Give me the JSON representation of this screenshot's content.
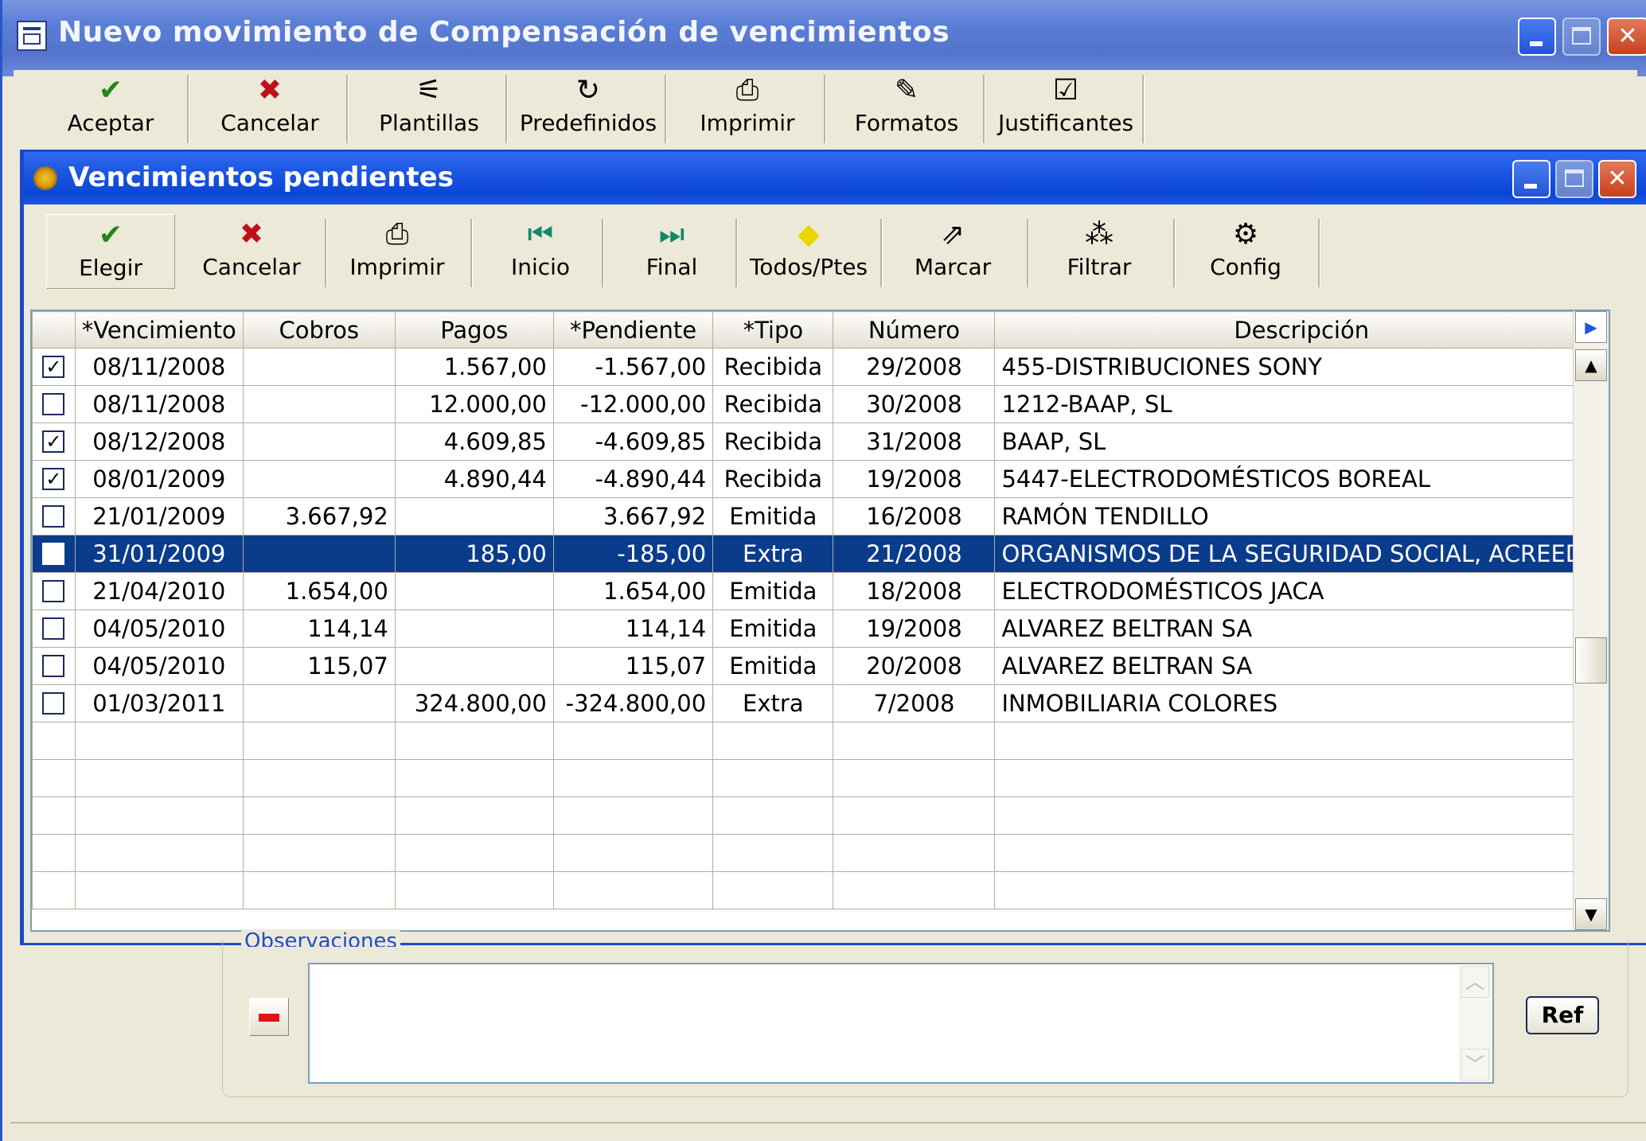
{
  "window": {
    "title": "Nuevo movimiento de Compensación de vencimientos",
    "icon": "window-icon"
  },
  "main_toolbar": [
    {
      "label": "Aceptar",
      "icon": "checkmark-icon",
      "glyph": "✔"
    },
    {
      "label": "Cancelar",
      "icon": "x-icon",
      "glyph": "✖"
    },
    {
      "label": "Plantillas",
      "icon": "wand-icon",
      "glyph": "⚟"
    },
    {
      "label": "Predefinidos",
      "icon": "refresh-icon",
      "glyph": "↻"
    },
    {
      "label": "Imprimir",
      "icon": "printer-icon",
      "glyph": "⎙"
    },
    {
      "label": "Formatos",
      "icon": "formats-icon",
      "glyph": "✎"
    },
    {
      "label": "Justificantes",
      "icon": "clipboard-check-icon",
      "glyph": "☑"
    }
  ],
  "inner_window": {
    "title": "Vencimientos pendientes",
    "icon": "sun-icon"
  },
  "inner_toolbar": [
    {
      "label": "Elegir",
      "icon": "checkmark-icon",
      "glyph": "✔"
    },
    {
      "label": "Cancelar",
      "icon": "x-icon",
      "glyph": "✖"
    },
    {
      "label": "Imprimir",
      "icon": "printer-icon",
      "glyph": "⎙"
    },
    {
      "label": "Inicio",
      "icon": "first-icon",
      "glyph": "⏮"
    },
    {
      "label": "Final",
      "icon": "last-icon",
      "glyph": "⏭"
    },
    {
      "label": "Todos/Ptes",
      "icon": "diamond-icon",
      "glyph": "◆"
    },
    {
      "label": "Marcar",
      "icon": "mark-icon",
      "glyph": "⇗"
    },
    {
      "label": "Filtrar",
      "icon": "filter-icon",
      "glyph": "⁂"
    },
    {
      "label": "Config",
      "icon": "gear-icon",
      "glyph": "⚙"
    }
  ],
  "grid": {
    "columns": [
      "*Vencimiento",
      "Cobros",
      "Pagos",
      "*Pendiente",
      "*Tipo",
      "Número",
      "Descripción"
    ],
    "rows": [
      {
        "checked": true,
        "vencimiento": "08/11/2008",
        "cobros": "",
        "pagos": "1.567,00",
        "pendiente": "-1.567,00",
        "tipo": "Recibida",
        "numero": "29/2008",
        "descripcion": "455-DISTRIBUCIONES SONY"
      },
      {
        "checked": false,
        "vencimiento": "08/11/2008",
        "cobros": "",
        "pagos": "12.000,00",
        "pendiente": "-12.000,00",
        "tipo": "Recibida",
        "numero": "30/2008",
        "descripcion": "1212-BAAP, SL"
      },
      {
        "checked": true,
        "vencimiento": "08/12/2008",
        "cobros": "",
        "pagos": "4.609,85",
        "pendiente": "-4.609,85",
        "tipo": "Recibida",
        "numero": "31/2008",
        "descripcion": "BAAP, SL"
      },
      {
        "checked": true,
        "vencimiento": "08/01/2009",
        "cobros": "",
        "pagos": "4.890,44",
        "pendiente": "-4.890,44",
        "tipo": "Recibida",
        "numero": "19/2008",
        "descripcion": "5447-ELECTRODOMÉSTICOS BOREAL"
      },
      {
        "checked": false,
        "vencimiento": "21/01/2009",
        "cobros": "3.667,92",
        "pagos": "",
        "pendiente": "3.667,92",
        "tipo": "Emitida",
        "numero": "16/2008",
        "descripcion": "RAMÓN TENDILLO"
      },
      {
        "checked": false,
        "selected": true,
        "vencimiento": "31/01/2009",
        "cobros": "",
        "pagos": "185,00",
        "pendiente": "-185,00",
        "tipo": "Extra",
        "numero": "21/2008",
        "descripcion": "ORGANISMOS DE LA SEGURIDAD SOCIAL, ACREEDO"
      },
      {
        "checked": false,
        "vencimiento": "21/04/2010",
        "cobros": "1.654,00",
        "pagos": "",
        "pendiente": "1.654,00",
        "tipo": "Emitida",
        "numero": "18/2008",
        "descripcion": "ELECTRODOMÉSTICOS JACA"
      },
      {
        "checked": false,
        "vencimiento": "04/05/2010",
        "cobros": "114,14",
        "pagos": "",
        "pendiente": "114,14",
        "tipo": "Emitida",
        "numero": "19/2008",
        "descripcion": "ALVAREZ BELTRAN SA"
      },
      {
        "checked": false,
        "vencimiento": "04/05/2010",
        "cobros": "115,07",
        "pagos": "",
        "pendiente": "115,07",
        "tipo": "Emitida",
        "numero": "20/2008",
        "descripcion": "ALVAREZ BELTRAN SA"
      },
      {
        "checked": false,
        "vencimiento": "01/03/2011",
        "cobros": "",
        "pagos": "324.800,00",
        "pendiente": "-324.800,00",
        "tipo": "Extra",
        "numero": "7/2008",
        "descripcion": "INMOBILIARIA COLORES"
      }
    ],
    "empty_rows": 5
  },
  "lower_panel": {
    "observaciones_label": "Observaciones",
    "ref_label": "Ref"
  },
  "colors": {
    "selection": "#0a3c8c",
    "title_bar": "#0a46d6",
    "accent_green": "#1f8a1a",
    "accent_red": "#c0101a"
  }
}
